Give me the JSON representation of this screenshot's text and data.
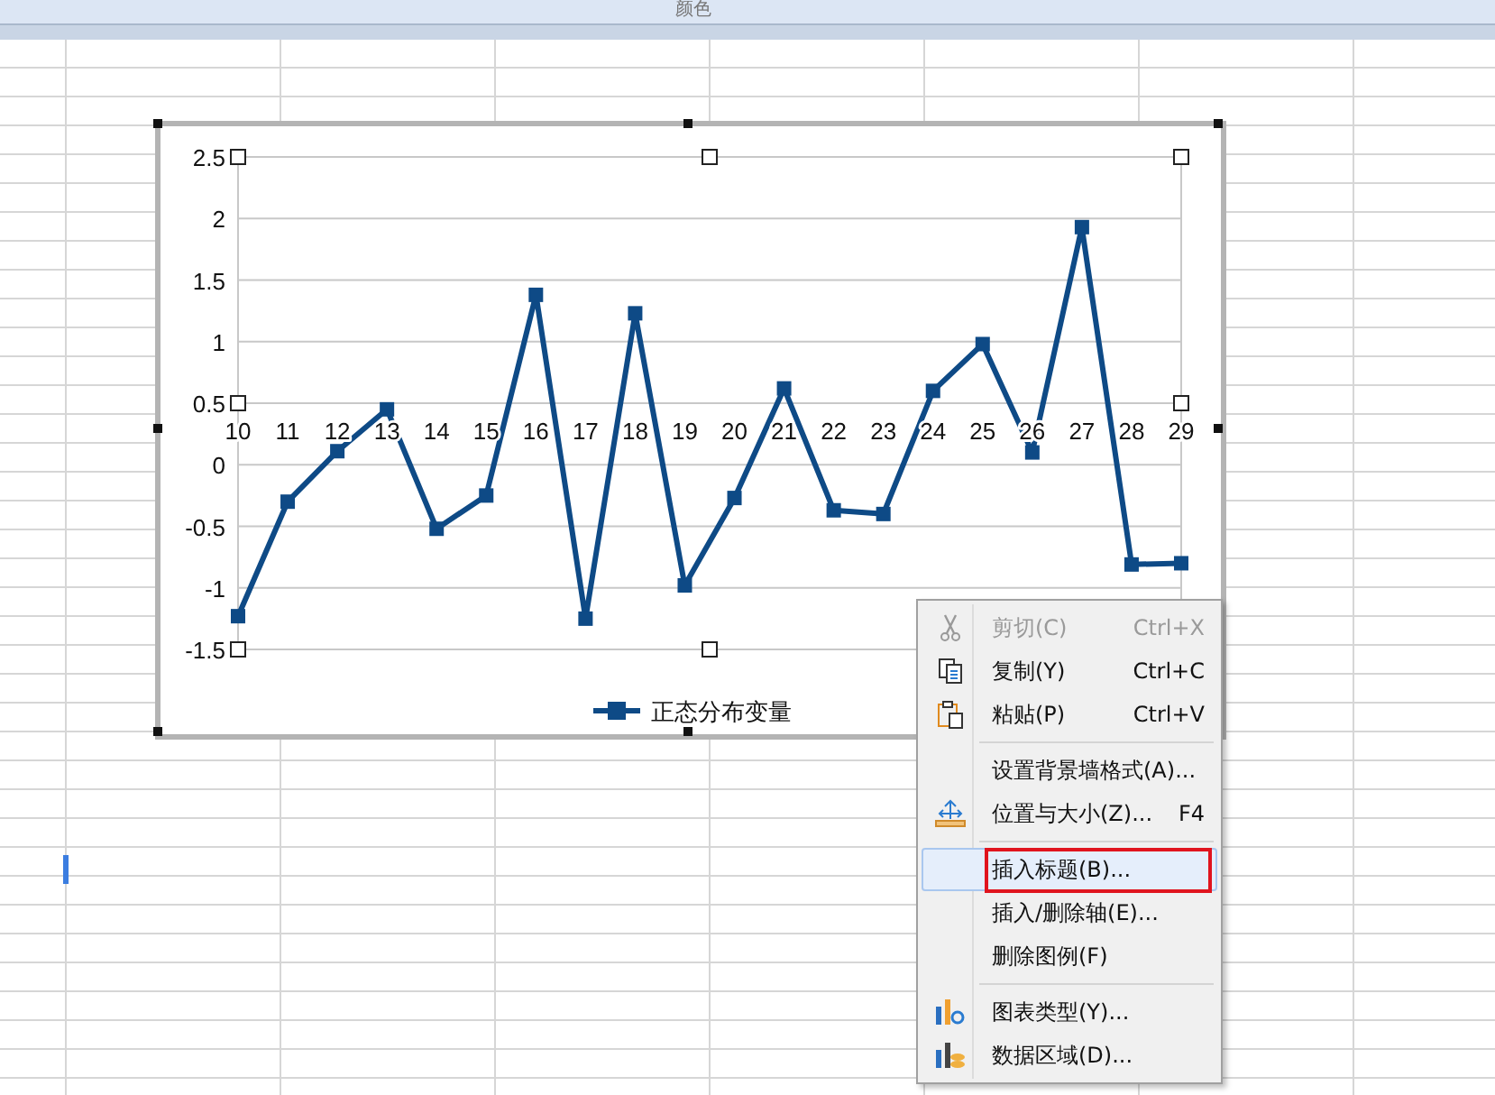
{
  "ribbon": {
    "group_label": "颜色"
  },
  "chart": {
    "chart_data": {
      "type": "line",
      "grid": true,
      "categories": [
        "10",
        "11",
        "12",
        "13",
        "14",
        "15",
        "16",
        "17",
        "18",
        "19",
        "20",
        "21",
        "22",
        "23",
        "24",
        "25",
        "26",
        "27",
        "28",
        "29"
      ],
      "ylim": [
        -1.5,
        2.5
      ],
      "yticks": [
        {
          "value": 2.5,
          "label": "2.5"
        },
        {
          "value": 2,
          "label": "2"
        },
        {
          "value": 1.5,
          "label": "1.5"
        },
        {
          "value": 1,
          "label": "1"
        },
        {
          "value": 0.5,
          "label": "0.5"
        },
        {
          "value": 0,
          "label": "0"
        },
        {
          "value": -0.5,
          "label": "-0.5"
        },
        {
          "value": -1,
          "label": "-1"
        },
        {
          "value": -1.5,
          "label": "-1.5"
        }
      ],
      "series": [
        {
          "name": "正态分布变量",
          "color": "#0e4a86",
          "marker": "square",
          "values": [
            -1.23,
            -0.3,
            0.11,
            0.45,
            -0.52,
            -0.25,
            1.38,
            -1.25,
            1.23,
            -0.98,
            -0.27,
            0.62,
            -0.37,
            -0.4,
            0.6,
            0.98,
            0.1,
            1.93,
            -0.81,
            -0.8
          ]
        }
      ]
    }
  },
  "context_menu": {
    "items": [
      {
        "kind": "cut",
        "label": "剪切(C)",
        "shortcut": "Ctrl+X",
        "disabled": true,
        "selected": false
      },
      {
        "kind": "copy",
        "label": "复制(Y)",
        "shortcut": "Ctrl+C",
        "disabled": false,
        "selected": false
      },
      {
        "kind": "paste",
        "label": "粘贴(P)",
        "shortcut": "Ctrl+V",
        "disabled": false,
        "selected": false
      },
      {
        "kind": "separator"
      },
      {
        "kind": "plain",
        "label": "设置背景墙格式(A)...",
        "disabled": false,
        "selected": false
      },
      {
        "kind": "position",
        "label": "位置与大小(Z)...",
        "shortcut": "F4",
        "disabled": false,
        "selected": false
      },
      {
        "kind": "separator"
      },
      {
        "kind": "plain",
        "label": "插入标题(B)...",
        "disabled": false,
        "selected": true
      },
      {
        "kind": "plain",
        "label": "插入/删除轴(E)...",
        "disabled": false,
        "selected": false
      },
      {
        "kind": "plain",
        "label": "删除图例(F)",
        "disabled": false,
        "selected": false
      },
      {
        "kind": "separator"
      },
      {
        "kind": "chart-type",
        "label": "图表类型(Y)...",
        "disabled": false,
        "selected": false
      },
      {
        "kind": "data-range",
        "label": "数据区域(D)...",
        "disabled": false,
        "selected": false
      }
    ]
  }
}
